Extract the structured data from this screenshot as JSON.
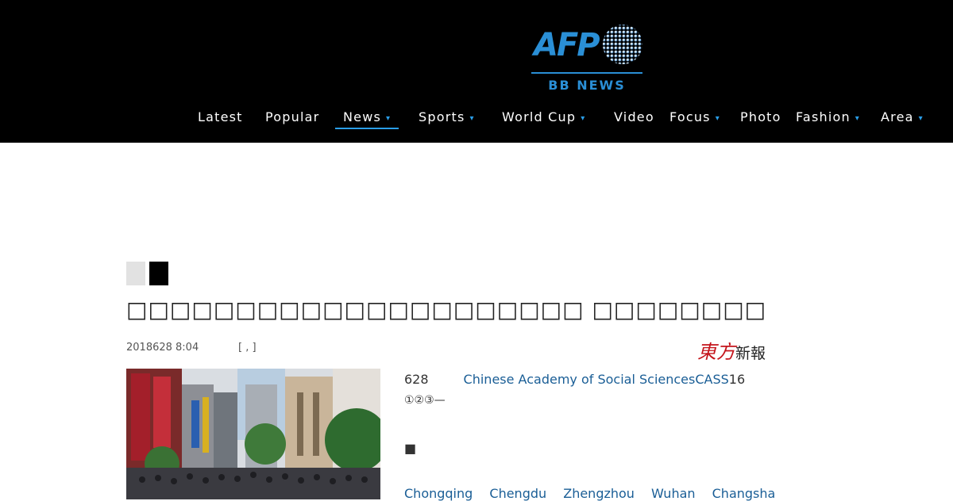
{
  "brand": {
    "name": "AFP",
    "subtitle": "BB NEWS",
    "accent": "#2a8fd6"
  },
  "nav": [
    {
      "label": "Latest",
      "dropdown": false
    },
    {
      "label": "Popular",
      "dropdown": false
    },
    {
      "label": "News",
      "dropdown": true,
      "active": true
    },
    {
      "label": "Sports",
      "dropdown": true
    },
    {
      "label": "World Cup",
      "dropdown": true
    },
    {
      "label": "Video",
      "dropdown": false
    },
    {
      "label": "Focus",
      "dropdown": true
    },
    {
      "label": "Photo",
      "dropdown": false
    },
    {
      "label": "Fashion",
      "dropdown": true
    },
    {
      "label": "Area",
      "dropdown": true
    }
  ],
  "nav_chevron": "▾",
  "article": {
    "title": "□□□□□□□□□□□□□□□□□□□□□ □□□□□□□□",
    "date": "2018628 8:04",
    "bracket": "[ ,     ]",
    "source_logo_main": "東方",
    "source_logo_small": "新報",
    "paragraph_start": "628",
    "paragraph_link": "Chinese Academy of Social SciencesCASS",
    "paragraph_end": "16",
    "markers": "①②③—",
    "square": "■",
    "cities": [
      "Chongqing",
      "Chengdu",
      "Zhengzhou",
      "Wuhan",
      "Changsha"
    ]
  }
}
